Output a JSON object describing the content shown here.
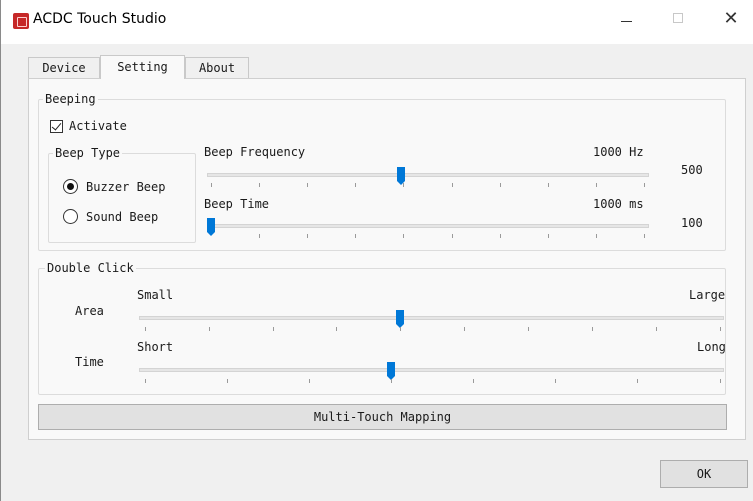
{
  "window": {
    "title": "ACDC Touch Studio",
    "app_icon": "app-logo-icon"
  },
  "tabs": [
    {
      "label": "Device",
      "active": false
    },
    {
      "label": "Setting",
      "active": true
    },
    {
      "label": "About",
      "active": false
    }
  ],
  "beeping": {
    "group_label": "Beeping",
    "activate_label": "Activate",
    "activate_checked": true,
    "beep_type": {
      "group_label": "Beep Type",
      "options": [
        {
          "label": "Buzzer Beep",
          "selected": true
        },
        {
          "label": "Sound Beep",
          "selected": false
        }
      ]
    },
    "frequency": {
      "label": "Beep Frequency",
      "value_text": "1000 Hz",
      "side_value": "500",
      "level": 0.44
    },
    "time": {
      "label": "Beep Time",
      "value_text": "1000 ms",
      "side_value": "100",
      "level": 0.0
    }
  },
  "double_click": {
    "group_label": "Double Click",
    "area": {
      "label": "Area",
      "min_label": "Small",
      "max_label": "Large",
      "level": 0.44
    },
    "time": {
      "label": "Time",
      "min_label": "Short",
      "max_label": "Long",
      "level": 0.42
    }
  },
  "multi_touch_button": "Multi-Touch Mapping",
  "ok_button": "OK",
  "colors": {
    "accent": "#0078d7",
    "app_icon": "#c62828"
  }
}
